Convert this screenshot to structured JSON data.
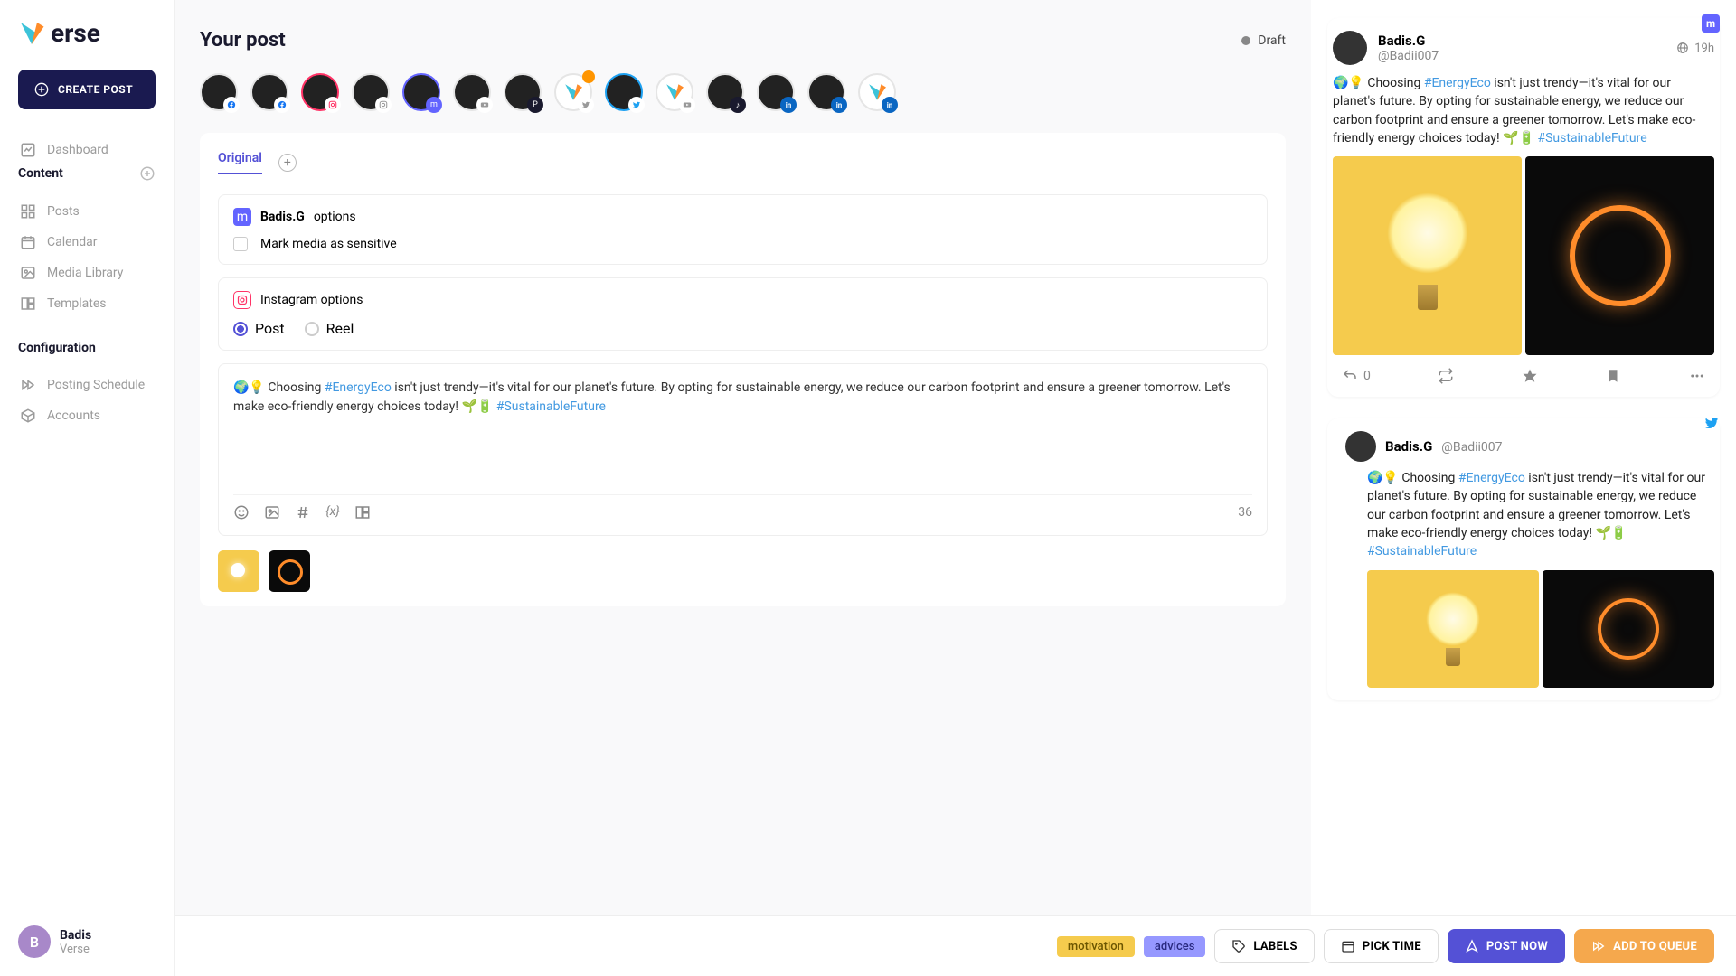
{
  "logo": {
    "text": "erse"
  },
  "sidebar": {
    "create": "CREATE POST",
    "dashboard": "Dashboard",
    "contentHeading": "Content",
    "posts": "Posts",
    "calendar": "Calendar",
    "mediaLibrary": "Media Library",
    "templates": "Templates",
    "configHeading": "Configuration",
    "postingSchedule": "Posting Schedule",
    "accounts": "Accounts",
    "username": "Badis",
    "org": "Verse",
    "initial": "B"
  },
  "main": {
    "title": "Your post",
    "status": "Draft",
    "tabOriginal": "Original",
    "options": {
      "mastodonUser": "Badis.G",
      "mastodonLabel": "options",
      "markSensitive": "Mark media as sensitive",
      "instagramLabel": "Instagram options",
      "postLabel": "Post",
      "reelLabel": "Reel"
    },
    "postText": {
      "prefix": "🌍💡 Choosing ",
      "hashtag1": "#EnergyEco",
      "middle": " isn't just trendy—it's vital for our planet's future. By opting for sustainable energy, we reduce our carbon footprint and ensure a greener tomorrow. Let's make eco-friendly energy choices today! 🌱🔋 ",
      "hashtag2": "#SustainableFuture"
    },
    "wordCount": "36",
    "tags": {
      "motivation": "motivation",
      "advices": "advices"
    },
    "buttons": {
      "labels": "LABELS",
      "pickTime": "PICK TIME",
      "postNow": "POST NOW",
      "addQueue": "ADD TO QUEUE"
    }
  },
  "preview": {
    "name": "Badis.G",
    "handle": "@Badii007",
    "time": "19h",
    "replyCount": "0"
  }
}
